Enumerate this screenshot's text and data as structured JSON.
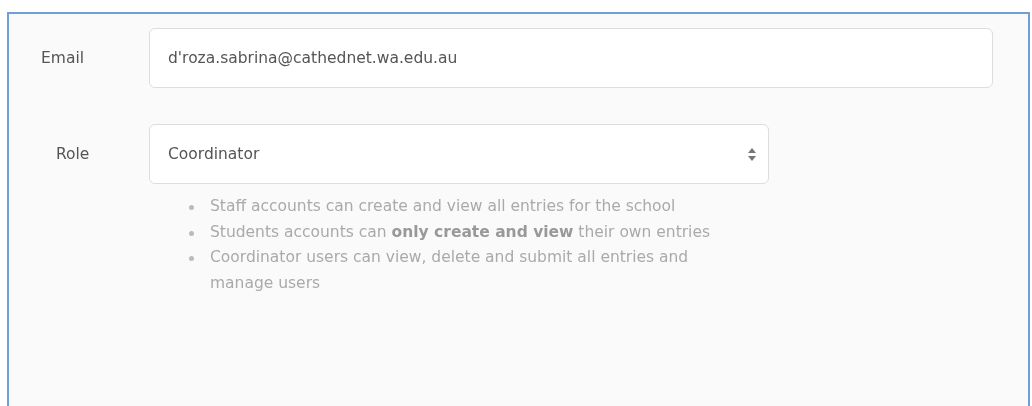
{
  "fields": [
    {
      "kind": "text",
      "label": "Email",
      "value": "d'roza.sabrina@cathednet.wa.edu.au"
    },
    {
      "kind": "select",
      "label": "Role",
      "value": "Coordinator",
      "help": [
        "Staff accounts can create and view all entries for the school",
        "Students accounts can **only create and view** their own entries",
        "Coordinator users can view, delete and submit all entries and manage users"
      ]
    }
  ]
}
